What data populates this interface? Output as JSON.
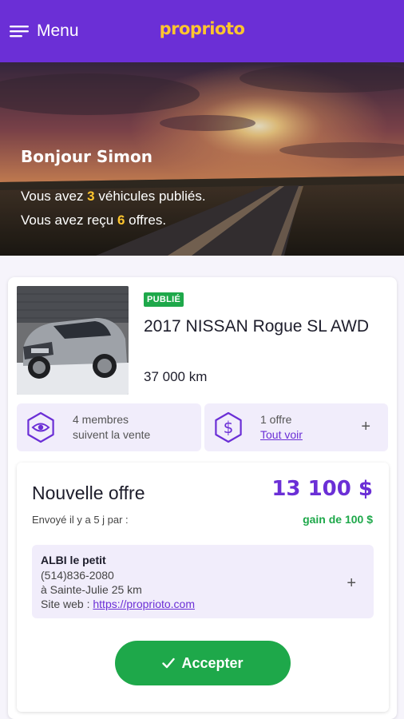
{
  "header": {
    "menu_label": "Menu",
    "logo_text": "proprioto",
    "bg_color": "#6b2fd6",
    "logo_color": "#ffc52e"
  },
  "hero": {
    "greeting": "Bonjour Simon",
    "line1_prefix": "Vous avez ",
    "vehicles_count": "3",
    "line1_suffix": " véhicules publiés.",
    "line2_prefix": "Vous avez reçu ",
    "offers_count": "6",
    "line2_suffix": " offres."
  },
  "vehicle": {
    "status_badge": "PUBLIÉ",
    "title": "2017 NISSAN Rogue SL AWD",
    "mileage": "37 000 km",
    "followers_line1": "4 membres",
    "followers_line2": "suivent la vente",
    "offers_line1": "1 offre",
    "offers_link": "Tout voir",
    "add_symbol": "+"
  },
  "offer": {
    "title": "Nouvelle offre",
    "price": "13 100 $",
    "sent": "Envoyé il y a 5 j par :",
    "gain": "gain de 100 $",
    "buyer_name": "ALBI le petit",
    "buyer_phone": "(514)836-2080",
    "buyer_location": "à Sainte-Julie 25 km",
    "buyer_site_prefix": "Site web : ",
    "buyer_site_url": "https://proprioto.com",
    "add_symbol": "+",
    "accept_label": "Accepter",
    "accent_color": "#1ea84a"
  },
  "icons": {
    "menu": "menu-icon",
    "eye": "eye-icon",
    "dollar": "dollar-icon",
    "check": "check-icon"
  }
}
